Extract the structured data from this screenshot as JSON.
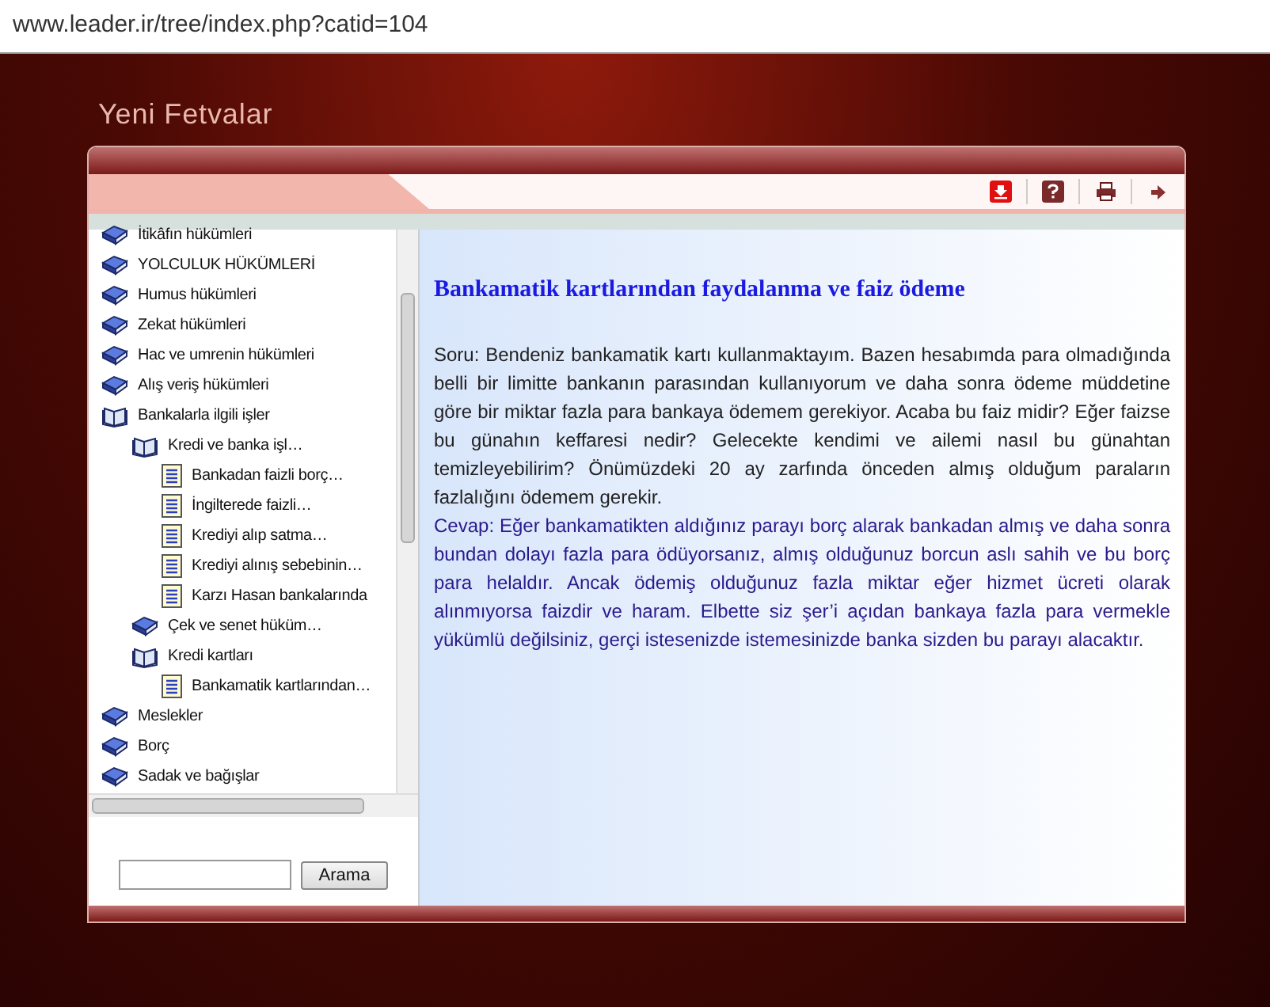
{
  "address_bar": {
    "url": "www.leader.ir/tree/index.php?catid=104"
  },
  "page_title": "Yeni Fetvalar",
  "tree": [
    {
      "label": "İtikâfın hükümleri",
      "kind": "book"
    },
    {
      "label": "YOLCULUK HÜKÜMLERİ",
      "kind": "book"
    },
    {
      "label": "Humus hükümleri",
      "kind": "book"
    },
    {
      "label": "Zekat hükümleri",
      "kind": "book"
    },
    {
      "label": "Hac ve umrenin hükümleri",
      "kind": "book"
    },
    {
      "label": "Alış veriş hükümleri",
      "kind": "book"
    },
    {
      "label": "Bankalarla ilgili işler",
      "kind": "open-book",
      "children": [
        {
          "label": "Kredi ve banka işl…",
          "kind": "open-book",
          "children": [
            {
              "label": "Bankadan faizli borç…",
              "kind": "page"
            },
            {
              "label": "İngilterede faizli…",
              "kind": "page"
            },
            {
              "label": "Krediyi alıp satma…",
              "kind": "page"
            },
            {
              "label": "Krediyi alınış sebebinin…",
              "kind": "page"
            },
            {
              "label": "Karzı Hasan bankalarında",
              "kind": "page"
            }
          ]
        },
        {
          "label": "Çek ve senet hüküm…",
          "kind": "book"
        },
        {
          "label": "Kredi kartları",
          "kind": "open-book",
          "children": [
            {
              "label": "Bankamatik kartlarından…",
              "kind": "page"
            }
          ]
        }
      ]
    },
    {
      "label": "Meslekler",
      "kind": "book"
    },
    {
      "label": "Borç",
      "kind": "book"
    },
    {
      "label": "Sadak ve bağışlar",
      "kind": "book"
    }
  ],
  "search": {
    "button": "Arama"
  },
  "article": {
    "title": "Bankamatik kartlarından faydalanma ve faiz ödeme",
    "question": "Soru: Bendeniz bankamatik kartı kullanmaktayım. Bazen hesabımda para olmadığında belli bir limitte bankanın parasından kullanıyorum ve daha sonra ödeme müddetine göre bir miktar fazla para bankaya ödemem gerekiyor. Acaba bu faiz midir? Eğer faizse bu günahın keffaresi nedir? Gelecekte kendimi ve ailemi nasıl bu günahtan temizleyebilirim? Önümüzdeki 20 ay  zarfında önceden almış olduğum paraların fazlalığını ödemem gerekir.",
    "answer": "Cevap: Eğer bankamatikten aldığınız parayı borç alarak bankadan almış ve daha sonra bundan dolayı fazla para ödüyorsanız, almış olduğunuz borcun aslı sahih ve bu borç para helaldır. Ancak ödemiş olduğunuz fazla miktar eğer hizmet ücreti olarak alınmıyorsa faizdir ve haram. Elbette siz şer’i açıdan bankaya fazla para vermekle yükümlü değilsiniz, gerçi istesenizde istemesinizde banka sizden bu parayı alacaktır."
  }
}
